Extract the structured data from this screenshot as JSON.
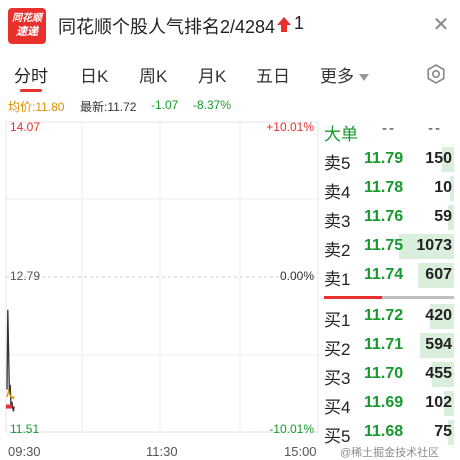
{
  "header": {
    "logo_line1": "同花顺",
    "logo_line2": "速递",
    "title": "同花顺个股人气排名2/4284",
    "rank_change": "1",
    "rank_arrow_icon": "arrow-up-icon",
    "close_icon": "close-icon"
  },
  "tabs": [
    {
      "label": "分时",
      "active": true
    },
    {
      "label": "日K"
    },
    {
      "label": "周K"
    },
    {
      "label": "月K"
    },
    {
      "label": "五日"
    },
    {
      "label": "更多"
    }
  ],
  "settings_icon": "settings-icon",
  "info": {
    "avg_label": "均价:11.80",
    "latest_label": "最新:11.72",
    "change": "-1.07",
    "change_pct": "-8.37%"
  },
  "chart": {
    "high_price": "14.07",
    "mid_price": "12.79",
    "low_price": "11.51",
    "high_pct": "+10.01%",
    "mid_pct": "0.00%",
    "low_pct": "-10.01%",
    "time_start": "09:30",
    "time_mid": "11:30",
    "time_end": "15:00"
  },
  "chart_data": {
    "type": "line",
    "title": "",
    "xlabel": "",
    "ylabel": "",
    "ylim": [
      11.51,
      14.07
    ],
    "x_ticks": [
      "09:30",
      "11:30",
      "15:00"
    ],
    "y_ticks_left": [
      "14.07",
      "12.79",
      "11.51"
    ],
    "y_ticks_right": [
      "+10.01%",
      "0.00%",
      "-10.01%"
    ],
    "series": [
      {
        "values": [
          11.86,
          12.52,
          12.18,
          11.83,
          11.9,
          11.72,
          11.76,
          11.72,
          11.68,
          11.72
        ]
      },
      {
        "values": [
          11.8,
          11.82,
          11.85,
          11.83,
          11.81,
          11.8,
          11.79,
          11.8,
          11.79,
          11.8
        ]
      }
    ],
    "grid": true
  },
  "order_book": {
    "header_label": "大单",
    "header_d1": "--",
    "header_d2": "--",
    "asks": [
      {
        "label": "卖5",
        "price": "11.79",
        "volume": "150",
        "fill": 0.12
      },
      {
        "label": "卖4",
        "price": "11.78",
        "volume": "10",
        "fill": 0.04
      },
      {
        "label": "卖3",
        "price": "11.76",
        "volume": "59",
        "fill": 0.06
      },
      {
        "label": "卖2",
        "price": "11.75",
        "volume": "1073",
        "fill": 0.55
      },
      {
        "label": "卖1",
        "price": "11.74",
        "volume": "607",
        "fill": 0.36
      }
    ],
    "bids": [
      {
        "label": "买1",
        "price": "11.72",
        "volume": "420",
        "fill": 0.24
      },
      {
        "label": "买2",
        "price": "11.71",
        "volume": "594",
        "fill": 0.34
      },
      {
        "label": "买3",
        "price": "11.70",
        "volume": "455",
        "fill": 0.22
      },
      {
        "label": "买4",
        "price": "11.69",
        "volume": "102",
        "fill": 0.1
      },
      {
        "label": "买5",
        "price": "11.68",
        "volume": "75",
        "fill": 0.06
      }
    ]
  },
  "watermark": "@稀土掘金技术社区"
}
